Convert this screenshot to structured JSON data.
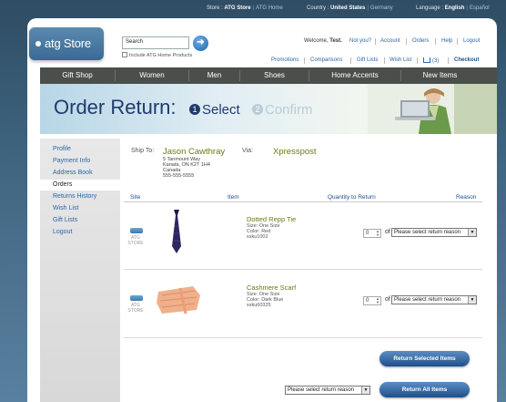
{
  "topbar": {
    "store_label": "Store :",
    "store_value": "ATG Store",
    "store_link": "ATG Home",
    "country_label": "Country :",
    "country_value": "United States",
    "country_link": "Germany",
    "language_label": "Language :",
    "language_value": "English",
    "language_link": "Español"
  },
  "logo": {
    "text": "atg Store"
  },
  "search": {
    "value": "Search",
    "checkbox_label": "Include ATG Home Products"
  },
  "account": {
    "welcome": "Welcome,",
    "user": "Test.",
    "not_you": "Not you?",
    "links": [
      "Account",
      "Orders",
      "Help",
      "Logout"
    ]
  },
  "utility": {
    "links": [
      "Promotions",
      "Comparisons",
      "Gift Lists",
      "Wish List"
    ],
    "cart_count": "(3)",
    "checkout": "Checkout"
  },
  "nav": [
    "Gift Shop",
    "Women",
    "Men",
    "Shoes",
    "Home Accents",
    "New Items"
  ],
  "banner": {
    "title": "Order Return:",
    "step1_num": "1",
    "step1_label": "Select",
    "step2_num": "2",
    "step2_label": "Confirm"
  },
  "sidebar": [
    "Profile",
    "Payment Info",
    "Address Book",
    "Orders",
    "Returns History",
    "Wish List",
    "Gift Lists",
    "Logout"
  ],
  "shipping": {
    "ship_to_label": "Ship To:",
    "name": "Jason Cawthray",
    "address": [
      "5 Tanmount Way",
      "Kanata, ON K2T 1H4",
      "Canada",
      "555-555-5555"
    ],
    "via_label": "Via:",
    "via": "Xpresspost"
  },
  "table": {
    "headers": [
      "Site",
      "Item",
      "Quantity to Return",
      "Reason"
    ],
    "rows": [
      {
        "site": "ATG STORE",
        "name": "Dotted Repp Tie",
        "size": "Size: One Size",
        "color": "Color: Red",
        "sku": "xsku1002",
        "qty": "0",
        "of": "of 82",
        "reason": "Please select return reason"
      },
      {
        "site": "ATG STORE",
        "name": "Cashmere Scarf",
        "size": "Size: One Size",
        "color": "Color: Dark Blue",
        "sku": "xsku60325",
        "qty": "0",
        "of": "of 1",
        "reason": "Please select return reason"
      }
    ]
  },
  "actions": {
    "return_selected": "Return Selected Items",
    "reason_all": "Please select return reason",
    "return_all": "Return All Items"
  },
  "colors": {
    "link": "#2a66a8",
    "title_blue": "#1f3a6e",
    "product_green": "#6a7a16",
    "nav_bg": "#4b4f4c"
  }
}
